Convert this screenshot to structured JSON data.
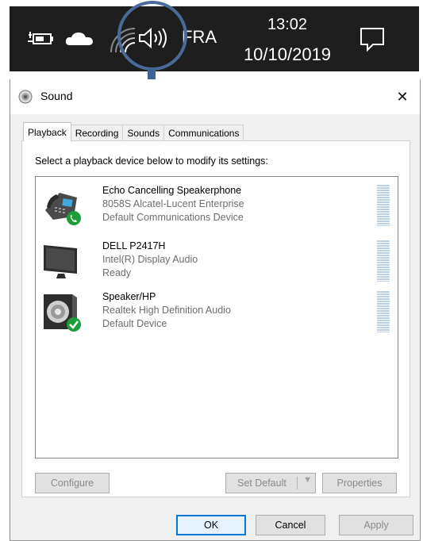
{
  "taskbar": {
    "language": "FRA",
    "time": "13:02",
    "date": "10/10/2019",
    "icons": [
      "battery-icon",
      "onedrive-cloud-icon",
      "wifi-icon",
      "volume-icon",
      "notification-icon"
    ]
  },
  "dialog": {
    "title": "Sound",
    "close_glyph": "✕",
    "tabs": [
      {
        "label": "Playback",
        "active": true
      },
      {
        "label": "Recording",
        "active": false
      },
      {
        "label": "Sounds",
        "active": false
      },
      {
        "label": "Communications",
        "active": false
      }
    ],
    "instruction": "Select a playback device below to modify its settings:",
    "devices": [
      {
        "name": "Echo Cancelling Speakerphone",
        "description": "8058S Alcatel-Lucent Enterprise",
        "status": "Default Communications Device",
        "icon": "desk-phone-icon",
        "badge": "phone-check-badge-icon"
      },
      {
        "name": "DELL P2417H",
        "description": "Intel(R) Display Audio",
        "status": "Ready",
        "icon": "monitor-icon",
        "badge": ""
      },
      {
        "name": "Speaker/HP",
        "description": "Realtek High Definition Audio",
        "status": "Default Device",
        "icon": "speaker-icon",
        "badge": "checkmark-badge-icon"
      }
    ],
    "buttons": {
      "configure": "Configure",
      "set_default": "Set Default",
      "properties": "Properties",
      "ok": "OK",
      "cancel": "Cancel",
      "apply": "Apply"
    }
  },
  "colors": {
    "taskbar_bg": "#1e1e1e",
    "highlight": "#4a6a9a",
    "accent": "#0078d7",
    "badge_green": "#1e9e3a",
    "meter": "#bcd0e6"
  }
}
